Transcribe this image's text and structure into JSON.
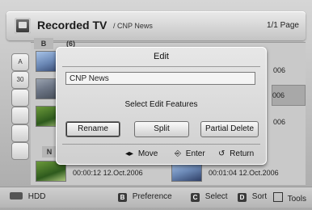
{
  "header": {
    "title": "Recorded TV",
    "breadcrumb": "/ CNP News",
    "page": "1/1 Page"
  },
  "list": {
    "group_b_label": "B",
    "group_b_count": "(6)",
    "group_n_label": "N",
    "right_rows": [
      "006",
      "006",
      "006"
    ],
    "bottom_items": [
      {
        "time": "00:00:12",
        "date": "12.Oct.2006"
      },
      {
        "time": "00:01:04",
        "date": "12.Oct.2006"
      }
    ]
  },
  "sidebar": {
    "icons": [
      "A-icon",
      "30-icon",
      "recording-icon",
      "list-icon",
      "disc-icon",
      "star-icon"
    ],
    "labels": [
      "A",
      "30",
      "",
      "",
      "",
      ""
    ]
  },
  "dialog": {
    "title": "Edit",
    "field_value": "CNP News",
    "instruction": "Select Edit Features",
    "buttons": [
      "Rename",
      "Split",
      "Partial Delete"
    ],
    "hints": {
      "move": "Move",
      "enter": "Enter",
      "return": "Return"
    },
    "hint_symbols": {
      "move": "◂▸",
      "enter": "⎆",
      "return": "↺"
    }
  },
  "bottombar": {
    "hdd": "HDD",
    "keys": [
      {
        "cap": "B",
        "label": "Preference"
      },
      {
        "cap": "C",
        "label": "Select"
      },
      {
        "cap": "D",
        "label": "Sort"
      }
    ],
    "tools": "Tools"
  },
  "colors": {
    "panel": "#c9c9c9",
    "dialog": "#e0e0e0",
    "selected_row": "#a8a8a8"
  }
}
